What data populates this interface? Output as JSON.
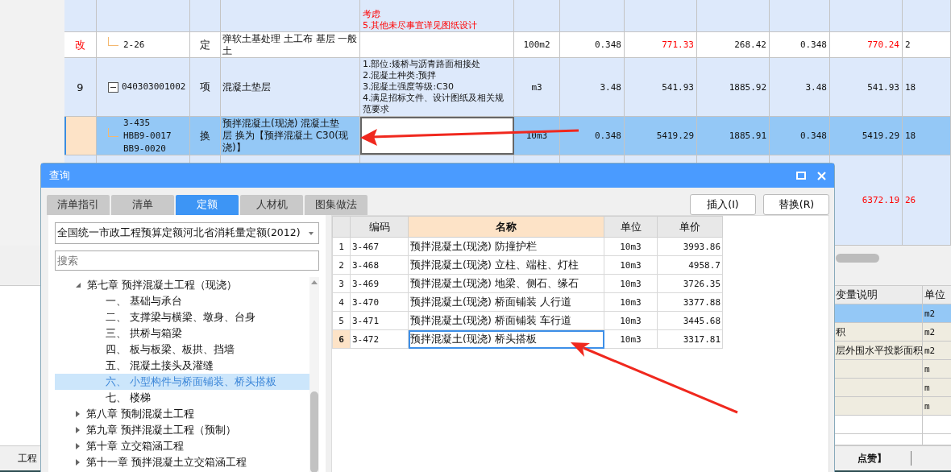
{
  "grid": {
    "rows": [
      {
        "kind": "item",
        "selected": false,
        "editing": false,
        "feature": [
          "考虑",
          "5.其他未尽事宜详见图纸设计"
        ],
        "feature_highlight": true
      },
      {
        "kind": "quota",
        "selected": false,
        "editing": false,
        "marker": "改",
        "marker_highlight": true,
        "code": [
          "2-26"
        ],
        "type": "定",
        "name": "弹软土基处理 土工布 基层 一般土",
        "values": [
          {
            "text": "100m2",
            "highlight": false
          },
          {
            "text": "0.348",
            "highlight": false
          },
          {
            "text": "771.33",
            "highlight": true
          },
          {
            "text": "268.42",
            "highlight": false
          },
          {
            "text": "0.348",
            "highlight": false
          },
          {
            "text": "770.24",
            "highlight": true
          },
          {
            "text": "2",
            "highlight": false
          }
        ]
      },
      {
        "kind": "item",
        "selected": false,
        "editing": false,
        "marker": "9",
        "marker_highlight": false,
        "expanded": true,
        "code": [
          "040303001002"
        ],
        "type": "项",
        "name": "混凝土垫层",
        "feature": [
          "1.部位:矮桥与沥青路面相接处",
          "2.混凝土种类:预拌",
          "3.混凝土强度等级:C30",
          "4.满足招标文件、设计图纸及相关规范要求"
        ],
        "feature_highlight": false,
        "values": [
          {
            "text": "m3",
            "highlight": false
          },
          {
            "text": "3.48",
            "highlight": false
          },
          {
            "text": "541.93",
            "highlight": false
          },
          {
            "text": "1885.92",
            "highlight": false
          },
          {
            "text": "3.48",
            "highlight": false
          },
          {
            "text": "541.93",
            "highlight": false
          },
          {
            "text": "18",
            "highlight": false
          }
        ]
      },
      {
        "kind": "quota",
        "selected": true,
        "editing": true,
        "code": [
          "3-435",
          "HBB9-0017",
          "BB9-0020"
        ],
        "type": "换",
        "name": "预拌混凝土(现浇) 混凝土垫层 换为【预拌混凝土 C30(现浇)】",
        "values": [
          {
            "text": "10m3",
            "highlight": false
          },
          {
            "text": "0.348",
            "highlight": false
          },
          {
            "text": "5419.29",
            "highlight": false
          },
          {
            "text": "1885.91",
            "highlight": false
          },
          {
            "text": "0.348",
            "highlight": false
          },
          {
            "text": "5419.29",
            "highlight": false
          },
          {
            "text": "18",
            "highlight": false
          }
        ]
      },
      {
        "kind": "item",
        "selected": false,
        "editing": false,
        "values": [
          {
            "text": "6372.19",
            "highlight": true
          },
          {
            "text": "26",
            "highlight": true
          }
        ]
      }
    ]
  },
  "variables": {
    "columns": [
      "变量说明",
      "单位"
    ],
    "rows": [
      {
        "unit": "m2",
        "selected": true
      },
      {
        "description": "积",
        "unit": "m2",
        "selected": false
      },
      {
        "description": "层外围水平投影面积",
        "unit": "m2",
        "selected": false
      },
      {
        "unit": "m",
        "selected": false
      },
      {
        "unit": "m",
        "selected": false
      },
      {
        "unit": "m",
        "selected": false
      }
    ]
  },
  "status_bar": {
    "left": "工程",
    "right": "点赞】"
  },
  "dialog": {
    "title": "查询",
    "tabs": [
      {
        "label": "清单指引",
        "selected": false
      },
      {
        "label": "清单",
        "selected": false
      },
      {
        "label": "定额",
        "selected": true
      },
      {
        "label": "人材机",
        "selected": false
      },
      {
        "label": "图集做法",
        "selected": false
      }
    ],
    "buttons": [
      "插入(I)",
      "替换(R)"
    ],
    "library": "全国统一市政工程预算定额河北省消耗量定额(2012)",
    "search_placeholder": "搜索",
    "tree": [
      {
        "label": "第七章 预拌混凝土工程（现浇）",
        "expanded": true,
        "selected": false,
        "children": [
          {
            "label": "一、 基础与承台",
            "selected": false
          },
          {
            "label": "二、 支撑梁与横梁、墩身、台身",
            "selected": false
          },
          {
            "label": "三、 拱桥与箱梁",
            "selected": false
          },
          {
            "label": "四、 板与板梁、板拱、挡墙",
            "selected": false
          },
          {
            "label": "五、 混凝土接头及灌缝",
            "selected": false
          },
          {
            "label": "六、 小型构件与桥面铺装、桥头搭板",
            "selected": true
          },
          {
            "label": "七、 楼梯",
            "selected": false
          }
        ]
      },
      {
        "label": "第八章 预制混凝土工程",
        "expanded": false,
        "selected": false
      },
      {
        "label": "第九章 预拌混凝土工程（预制）",
        "expanded": false,
        "selected": false
      },
      {
        "label": "第十章 立交箱涵工程",
        "expanded": false,
        "selected": false
      },
      {
        "label": "第十一章 预拌混凝土立交箱涵工程",
        "expanded": false,
        "selected": false
      }
    ],
    "results": {
      "columns": [
        {
          "label": "编码",
          "selected": false
        },
        {
          "label": "名称",
          "selected": true
        },
        {
          "label": "单位",
          "selected": false
        },
        {
          "label": "单价",
          "selected": false
        }
      ],
      "rows": [
        {
          "index": "1",
          "code": "3-467",
          "name": "预拌混凝土(现浇) 防撞护栏",
          "unit": "10m3",
          "price": "3993.86",
          "selected": false
        },
        {
          "index": "2",
          "code": "3-468",
          "name": "预拌混凝土(现浇) 立柱、端柱、灯柱",
          "unit": "10m3",
          "price": "4958.7",
          "selected": false
        },
        {
          "index": "3",
          "code": "3-469",
          "name": "预拌混凝土(现浇) 地梁、侧石、缘石",
          "unit": "10m3",
          "price": "3726.35",
          "selected": false
        },
        {
          "index": "4",
          "code": "3-470",
          "name": "预拌混凝土(现浇) 桥面铺装 人行道",
          "unit": "10m3",
          "price": "3377.88",
          "selected": false
        },
        {
          "index": "5",
          "code": "3-471",
          "name": "预拌混凝土(现浇) 桥面铺装 车行道",
          "unit": "10m3",
          "price": "3445.68",
          "selected": false
        },
        {
          "index": "6",
          "code": "3-472",
          "name": "预拌混凝土(现浇) 桥头搭板",
          "unit": "10m3",
          "price": "3317.81",
          "selected": true
        }
      ]
    }
  }
}
